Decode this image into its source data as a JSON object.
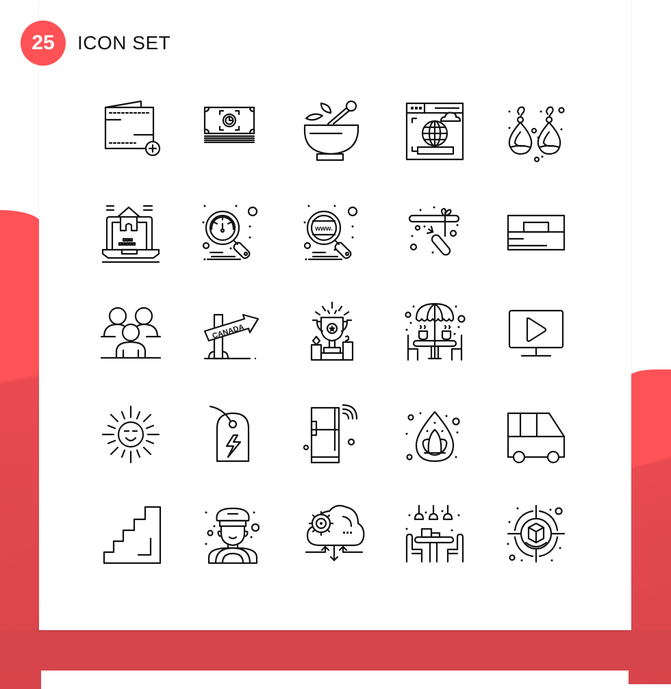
{
  "header": {
    "badge_number": "25",
    "title": "ICON SET"
  },
  "colors": {
    "accent": "#fe5257",
    "accent_dark": "#d5454b",
    "icon_stroke": "#111111",
    "background": "#ffffff"
  },
  "icons": [
    {
      "name": "wallet-add-icon",
      "row": 1,
      "col": 1
    },
    {
      "name": "money-stack-icon",
      "row": 1,
      "col": 2
    },
    {
      "name": "mortar-pestle-icon",
      "row": 1,
      "col": 3
    },
    {
      "name": "browser-globe-icon",
      "row": 1,
      "col": 4
    },
    {
      "name": "earrings-icon",
      "row": 1,
      "col": 5
    },
    {
      "name": "laptop-house-icon",
      "row": 2,
      "col": 1
    },
    {
      "name": "search-speedometer-icon",
      "row": 2,
      "col": 2
    },
    {
      "name": "search-www-icon",
      "row": 2,
      "col": 3
    },
    {
      "name": "carrot-stick-icon",
      "row": 2,
      "col": 4
    },
    {
      "name": "card-box-icon",
      "row": 2,
      "col": 5
    },
    {
      "name": "user-group-icon",
      "row": 3,
      "col": 1
    },
    {
      "name": "canada-signpost-icon",
      "row": 3,
      "col": 2,
      "label": "CANADA"
    },
    {
      "name": "trophy-icon",
      "row": 3,
      "col": 3
    },
    {
      "name": "cafe-umbrella-icon",
      "row": 3,
      "col": 4
    },
    {
      "name": "monitor-play-icon",
      "row": 3,
      "col": 5
    },
    {
      "name": "smiling-sun-icon",
      "row": 4,
      "col": 1
    },
    {
      "name": "energy-tag-icon",
      "row": 4,
      "col": 2
    },
    {
      "name": "smart-fridge-icon",
      "row": 4,
      "col": 3
    },
    {
      "name": "lotus-drop-icon",
      "row": 4,
      "col": 4
    },
    {
      "name": "van-icon",
      "row": 4,
      "col": 5
    },
    {
      "name": "stairs-icon",
      "row": 5,
      "col": 1
    },
    {
      "name": "chauffeur-icon",
      "row": 5,
      "col": 2
    },
    {
      "name": "cloud-settings-icon",
      "row": 5,
      "col": 3
    },
    {
      "name": "dining-table-icon",
      "row": 5,
      "col": 4
    },
    {
      "name": "target-box-icon",
      "row": 5,
      "col": 5
    }
  ],
  "www_label": "www.",
  "sign_label": "CANADA"
}
